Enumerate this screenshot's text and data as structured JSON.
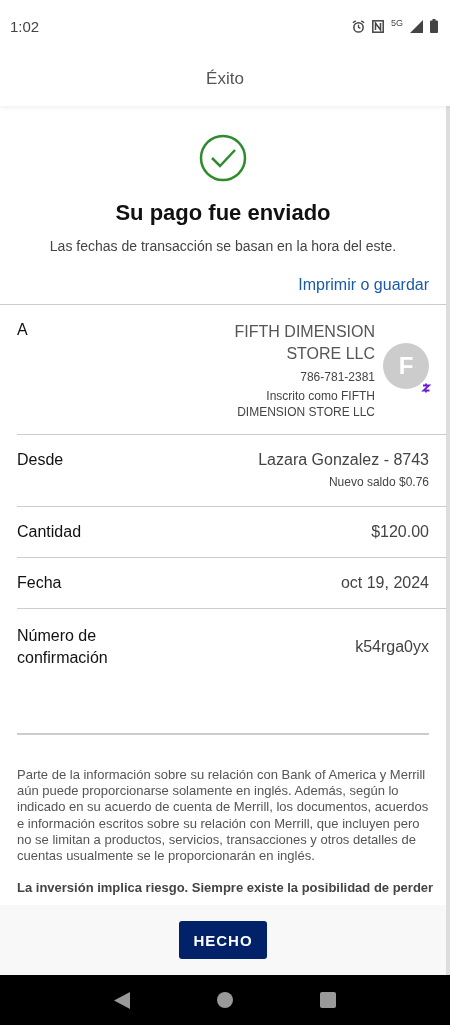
{
  "status_bar": {
    "time": "1:02",
    "network": "5G"
  },
  "header": {
    "title": "Éxito"
  },
  "confirmation": {
    "title": "Su pago fue enviado",
    "subtitle": "Las fechas de transacción se basan en la hora del este.",
    "print_link": "Imprimir o guardar"
  },
  "recipient": {
    "label": "A",
    "name": "FIFTH DIMENSION STORE LLC",
    "phone": "786-781-2381",
    "enrolled_as": "Inscrito como FIFTH DIMENSION STORE LLC",
    "avatar_letter": "F"
  },
  "details": [
    {
      "label": "Desde",
      "value": "Lazara Gonzalez - 8743",
      "note": "Nuevo saldo $0.76"
    },
    {
      "label": "Cantidad",
      "value": "$120.00"
    },
    {
      "label": "Fecha",
      "value": "oct 19, 2024"
    },
    {
      "label": "Número de confirmación",
      "value": "k54rga0yx"
    }
  ],
  "disclaimer": "Parte de la información sobre su relación con Bank of America y Merrill aún puede proporcionarse solamente en inglés. Además, según lo indicado en su acuerdo de cuenta de Merrill, los documentos, acuerdos e información escritos sobre su relación con Merrill, que incluyen pero no se limitan a productos, servicios, transacciones y otros detalles de cuentas usualmente se le proporcionarán en inglés.",
  "risk_notice": "La inversión implica riesgo. Siempre existe la posibilidad de perder",
  "done_button": "HECHO"
}
